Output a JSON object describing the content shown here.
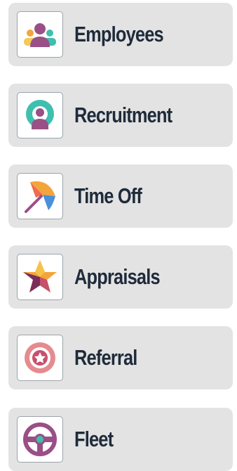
{
  "apps": [
    {
      "id": "employees",
      "label": "Employees",
      "icon": "employees-icon"
    },
    {
      "id": "recruitment",
      "label": "Recruitment",
      "icon": "recruitment-icon"
    },
    {
      "id": "time-off",
      "label": "Time Off",
      "icon": "umbrella-icon"
    },
    {
      "id": "appraisals",
      "label": "Appraisals",
      "icon": "star-icon"
    },
    {
      "id": "referral",
      "label": "Referral",
      "icon": "referral-badge-icon"
    },
    {
      "id": "fleet",
      "label": "Fleet",
      "icon": "steering-wheel-icon"
    }
  ],
  "colors": {
    "card_background": "#e3e3e3",
    "label_text": "#1f2b3a",
    "purple": "#9a4f86",
    "teal": "#3fbfae",
    "orange": "#f3a43b",
    "blue": "#4a90d9",
    "pink": "#e58b8f"
  }
}
